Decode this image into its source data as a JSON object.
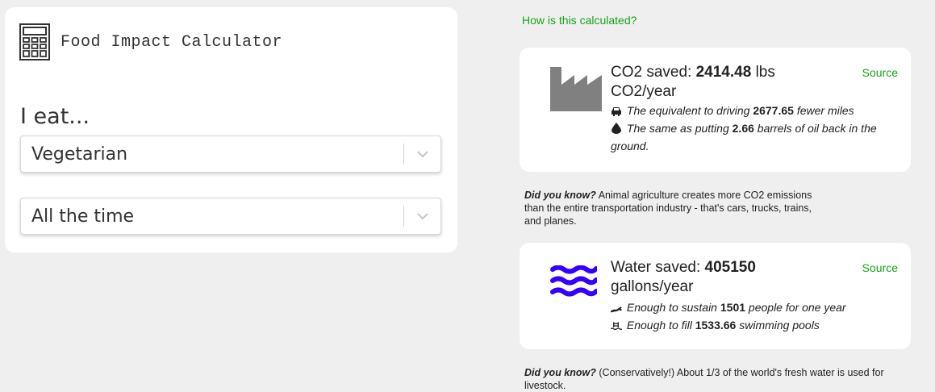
{
  "calculator": {
    "title": "Food Impact Calculator",
    "prompt": "I eat...",
    "diet_select": {
      "value": "Vegetarian"
    },
    "frequency_select": {
      "value": "All the time"
    }
  },
  "how_link": "How is this calculated?",
  "co2": {
    "label": "CO2 saved:",
    "value": "2414.48",
    "unit": "lbs CO2/year",
    "source": "Source",
    "fact1": {
      "pre": "The equivalent to driving",
      "value": "2677.65",
      "post": "fewer miles"
    },
    "fact2": {
      "pre": "The same as putting",
      "value": "2.66",
      "post": "barrels of oil back in the ground."
    }
  },
  "co2_did_you_know": {
    "lead": "Did you know?",
    "text": "Animal agriculture creates more CO2 emissions than the entire transportation industry - that's cars, trucks, trains, and planes."
  },
  "water": {
    "label": "Water saved:",
    "value": "405150",
    "unit": "gallons/year",
    "source": "Source",
    "fact1": {
      "pre": "Enough to sustain",
      "value": "1501",
      "post": "people for one year"
    },
    "fact2": {
      "pre": "Enough to fill",
      "value": "1533.66",
      "post": "swimming pools"
    }
  },
  "water_did_you_know": {
    "lead": "Did you know?",
    "text": "(Conservatively!) About 1/3 of the world's fresh water is used for livestock."
  },
  "colors": {
    "accent_green": "#17a317",
    "water_blue": "#3300ff",
    "factory_gray": "#808080"
  }
}
